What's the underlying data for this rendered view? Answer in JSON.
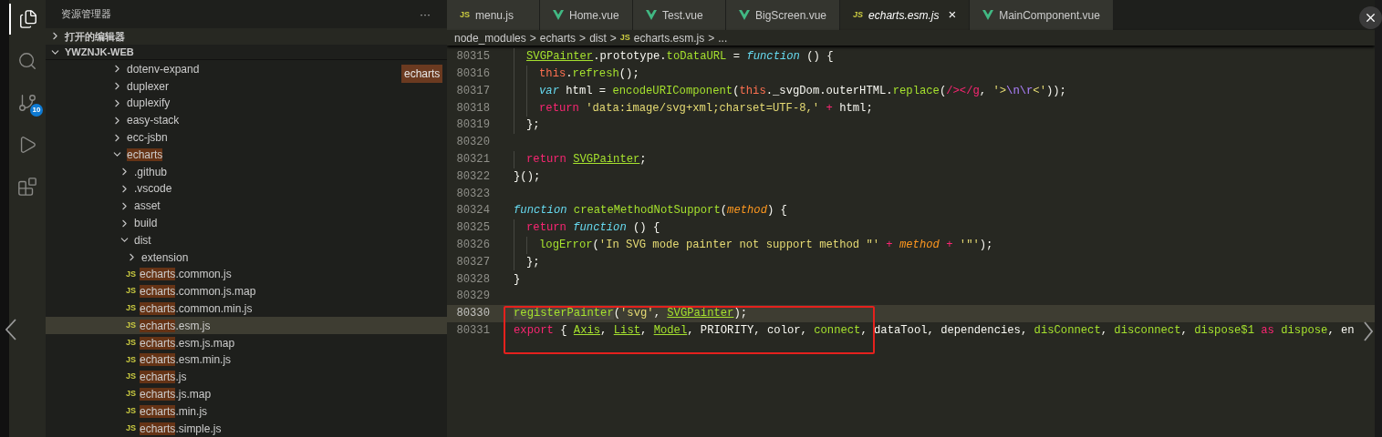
{
  "activity_bar": [
    {
      "kind": "files",
      "selected": true
    },
    {
      "kind": "search",
      "selected": false
    },
    {
      "kind": "scm",
      "selected": false,
      "badge": "10"
    },
    {
      "kind": "debug",
      "selected": false
    },
    {
      "kind": "extensions",
      "selected": false
    }
  ],
  "explorer": {
    "title": "资源管理器",
    "more": "···",
    "hover_tag": "echarts",
    "sections": [
      {
        "label": "打开的编辑器",
        "expanded": false
      },
      {
        "label": "YWZNJK-WEB",
        "expanded": true
      }
    ],
    "tree": [
      {
        "kind": "folder",
        "label": "dotenv-expand",
        "expanded": false,
        "selected": false
      },
      {
        "kind": "folder",
        "label": "duplexer",
        "expanded": false,
        "selected": false
      },
      {
        "kind": "folder",
        "label": "duplexify",
        "expanded": false,
        "selected": false
      },
      {
        "kind": "folder",
        "label": "easy-stack",
        "expanded": false,
        "selected": false
      },
      {
        "kind": "folder",
        "label": "ecc-jsbn",
        "expanded": false,
        "selected": false
      },
      {
        "kind": "folder",
        "match": "echarts",
        "expanded": true,
        "selected": false,
        "children": [
          {
            "kind": "folder",
            "label": ".github",
            "expanded": false,
            "selected": false
          },
          {
            "kind": "folder",
            "label": ".vscode",
            "expanded": false,
            "selected": false
          },
          {
            "kind": "folder",
            "label": "asset",
            "expanded": false,
            "selected": false
          },
          {
            "kind": "folder",
            "label": "build",
            "expanded": false,
            "selected": false
          },
          {
            "kind": "folder",
            "label": "dist",
            "expanded": true,
            "selected": false,
            "children": [
              {
                "kind": "folder",
                "label": "extension",
                "expanded": false,
                "selected": false
              },
              {
                "kind": "file",
                "icon_text": "JS",
                "match": "echarts",
                "label": ".common.js",
                "selected": false
              },
              {
                "kind": "file",
                "icon_text": "JS",
                "match": "echarts",
                "label": ".common.js.map",
                "selected": false
              },
              {
                "kind": "file",
                "icon_text": "JS",
                "match": "echarts",
                "label": ".common.min.js",
                "selected": false
              },
              {
                "kind": "file",
                "icon_text": "JS",
                "match": "echarts",
                "label": ".esm.js",
                "selected": true
              },
              {
                "kind": "file",
                "icon_text": "JS",
                "match": "echarts",
                "label": ".esm.js.map",
                "selected": false
              },
              {
                "kind": "file",
                "icon_text": "JS",
                "match": "echarts",
                "label": ".esm.min.js",
                "selected": false
              },
              {
                "kind": "file",
                "icon_text": "JS",
                "match": "echarts",
                "label": ".js",
                "selected": false
              },
              {
                "kind": "file",
                "icon_text": "JS",
                "match": "echarts",
                "label": ".js.map",
                "selected": false
              },
              {
                "kind": "file",
                "icon_text": "JS",
                "match": "echarts",
                "label": ".min.js",
                "selected": false
              },
              {
                "kind": "file",
                "icon_text": "JS",
                "match": "echarts",
                "label": ".simple.js",
                "selected": false
              }
            ]
          }
        ]
      }
    ]
  },
  "tabs": [
    {
      "kind": "js",
      "icon_text": "JS",
      "label": "menu.js",
      "selected": false
    },
    {
      "kind": "vue",
      "label": "Home.vue",
      "selected": false
    },
    {
      "kind": "vue",
      "label": "Test.vue",
      "selected": false
    },
    {
      "kind": "vue",
      "label": "BigScreen.vue",
      "selected": false
    },
    {
      "kind": "js",
      "icon_text": "JS",
      "label": "echarts.esm.js",
      "selected": true,
      "close": "×"
    },
    {
      "kind": "vue",
      "label": "MainComponent.vue",
      "selected": false
    }
  ],
  "breadcrumb": [
    {
      "label": "node_modules"
    },
    {
      "label": "echarts"
    },
    {
      "label": "dist"
    },
    {
      "icon_text": "JS",
      "label": "echarts.esm.js"
    },
    {
      "label": "..."
    }
  ],
  "breadcrumb_separator": ">",
  "code": [
    {
      "number": "80315",
      "current": false,
      "indented": true,
      "double_indent": false,
      "tokens": [
        {
          "kind": "ref",
          "text": "SVGPainter"
        },
        {
          "kind": "plain",
          "text": ".prototype."
        },
        {
          "kind": "fn",
          "text": "toDataURL"
        },
        {
          "kind": "plain",
          "text": " = "
        },
        {
          "kind": "storage",
          "text": "function"
        },
        {
          "kind": "plain",
          "text": " () {"
        }
      ]
    },
    {
      "number": "80316",
      "current": false,
      "indented": true,
      "double_indent": true,
      "tokens": [
        {
          "kind": "this",
          "text": "this"
        },
        {
          "kind": "plain",
          "text": "."
        },
        {
          "kind": "fn",
          "text": "refresh"
        },
        {
          "kind": "plain",
          "text": "();"
        }
      ]
    },
    {
      "number": "80317",
      "current": false,
      "indented": true,
      "double_indent": true,
      "tokens": [
        {
          "kind": "storage",
          "text": "var"
        },
        {
          "kind": "plain",
          "text": " html = "
        },
        {
          "kind": "fn",
          "text": "encodeURIComponent"
        },
        {
          "kind": "plain",
          "text": "("
        },
        {
          "kind": "this",
          "text": "this"
        },
        {
          "kind": "plain",
          "text": "._svgDom.outerHTML."
        },
        {
          "kind": "fn",
          "text": "replace"
        },
        {
          "kind": "plain",
          "text": "("
        },
        {
          "kind": "regex",
          "text": "/></g"
        },
        {
          "kind": "plain",
          "text": ", "
        },
        {
          "kind": "str",
          "text": "'>"
        },
        {
          "kind": "esc",
          "text": "\\n\\r"
        },
        {
          "kind": "str",
          "text": "<'"
        },
        {
          "kind": "plain",
          "text": "));"
        }
      ]
    },
    {
      "number": "80318",
      "current": false,
      "indented": true,
      "double_indent": true,
      "tokens": [
        {
          "kind": "kw",
          "text": "return "
        },
        {
          "kind": "str",
          "text": "'data:image/svg+xml;charset=UTF-8,' "
        },
        {
          "kind": "kw",
          "text": "+"
        },
        {
          "kind": "plain",
          "text": " html;"
        }
      ]
    },
    {
      "number": "80319",
      "current": false,
      "indented": true,
      "double_indent": false,
      "tokens": [
        {
          "kind": "plain",
          "text": "};"
        }
      ]
    },
    {
      "number": "80320",
      "current": false
    },
    {
      "number": "80321",
      "current": false,
      "indented": true,
      "double_indent": false,
      "tokens": [
        {
          "kind": "kw",
          "text": "return "
        },
        {
          "kind": "ref",
          "text": "SVGPainter"
        },
        {
          "kind": "plain",
          "text": ";"
        }
      ]
    },
    {
      "number": "80322",
      "current": false,
      "tokens": [
        {
          "kind": "plain",
          "text": "}();"
        }
      ]
    },
    {
      "number": "80323",
      "current": false
    },
    {
      "number": "80324",
      "current": false,
      "tokens": [
        {
          "kind": "storage",
          "text": "function"
        },
        {
          "kind": "fn",
          "text": " createMethodNotSupport"
        },
        {
          "kind": "plain",
          "text": "("
        },
        {
          "kind": "param",
          "text": "method"
        },
        {
          "kind": "plain",
          "text": ") {"
        }
      ]
    },
    {
      "number": "80325",
      "current": false,
      "indented": true,
      "double_indent": false,
      "tokens": [
        {
          "kind": "kw",
          "text": "return "
        },
        {
          "kind": "storage",
          "text": "function"
        },
        {
          "kind": "plain",
          "text": " () {"
        }
      ]
    },
    {
      "number": "80326",
      "current": false,
      "indented": true,
      "double_indent": true,
      "tokens": [
        {
          "kind": "fn",
          "text": "logError"
        },
        {
          "kind": "plain",
          "text": "("
        },
        {
          "kind": "str",
          "text": "'In SVG mode painter not support method \"' "
        },
        {
          "kind": "kw",
          "text": "+ "
        },
        {
          "kind": "param",
          "text": "method "
        },
        {
          "kind": "kw",
          "text": "+ "
        },
        {
          "kind": "str",
          "text": "'\"'"
        },
        {
          "kind": "plain",
          "text": ");"
        }
      ]
    },
    {
      "number": "80327",
      "current": false,
      "indented": true,
      "double_indent": false,
      "tokens": [
        {
          "kind": "plain",
          "text": "};"
        }
      ]
    },
    {
      "number": "80328",
      "current": false,
      "tokens": [
        {
          "kind": "plain",
          "text": "}"
        }
      ]
    },
    {
      "number": "80329",
      "current": false
    },
    {
      "number": "80330",
      "current": true,
      "tokens": [
        {
          "kind": "sel",
          "text": "registerPainter"
        },
        {
          "kind": "plain",
          "text": "("
        },
        {
          "kind": "str",
          "text": "'svg'"
        },
        {
          "kind": "plain",
          "text": ", "
        },
        {
          "kind": "ref",
          "text": "SVGPainter"
        },
        {
          "kind": "plain",
          "text": ");"
        }
      ]
    },
    {
      "number": "80331",
      "current": false,
      "tokens": [
        {
          "kind": "kw",
          "text": "export"
        },
        {
          "kind": "plain",
          "text": " { "
        },
        {
          "kind": "ref",
          "text": "Axis"
        },
        {
          "kind": "plain",
          "text": ", "
        },
        {
          "kind": "ref",
          "text": "List"
        },
        {
          "kind": "plain",
          "text": ", "
        },
        {
          "kind": "ref",
          "text": "Model"
        },
        {
          "kind": "plain",
          "text": ", PRIORITY, color, "
        },
        {
          "kind": "fn",
          "text": "connect"
        },
        {
          "kind": "plain",
          "text": ", dataTool, dependencies, "
        },
        {
          "kind": "fn",
          "text": "disConnect"
        },
        {
          "kind": "plain",
          "text": ", "
        },
        {
          "kind": "fn",
          "text": "disconnect"
        },
        {
          "kind": "plain",
          "text": ", "
        },
        {
          "kind": "fn",
          "text": "dispose$1 "
        },
        {
          "kind": "kw",
          "text": "as "
        },
        {
          "kind": "fn",
          "text": "dispose"
        },
        {
          "kind": "plain",
          "text": ", en"
        }
      ]
    }
  ]
}
